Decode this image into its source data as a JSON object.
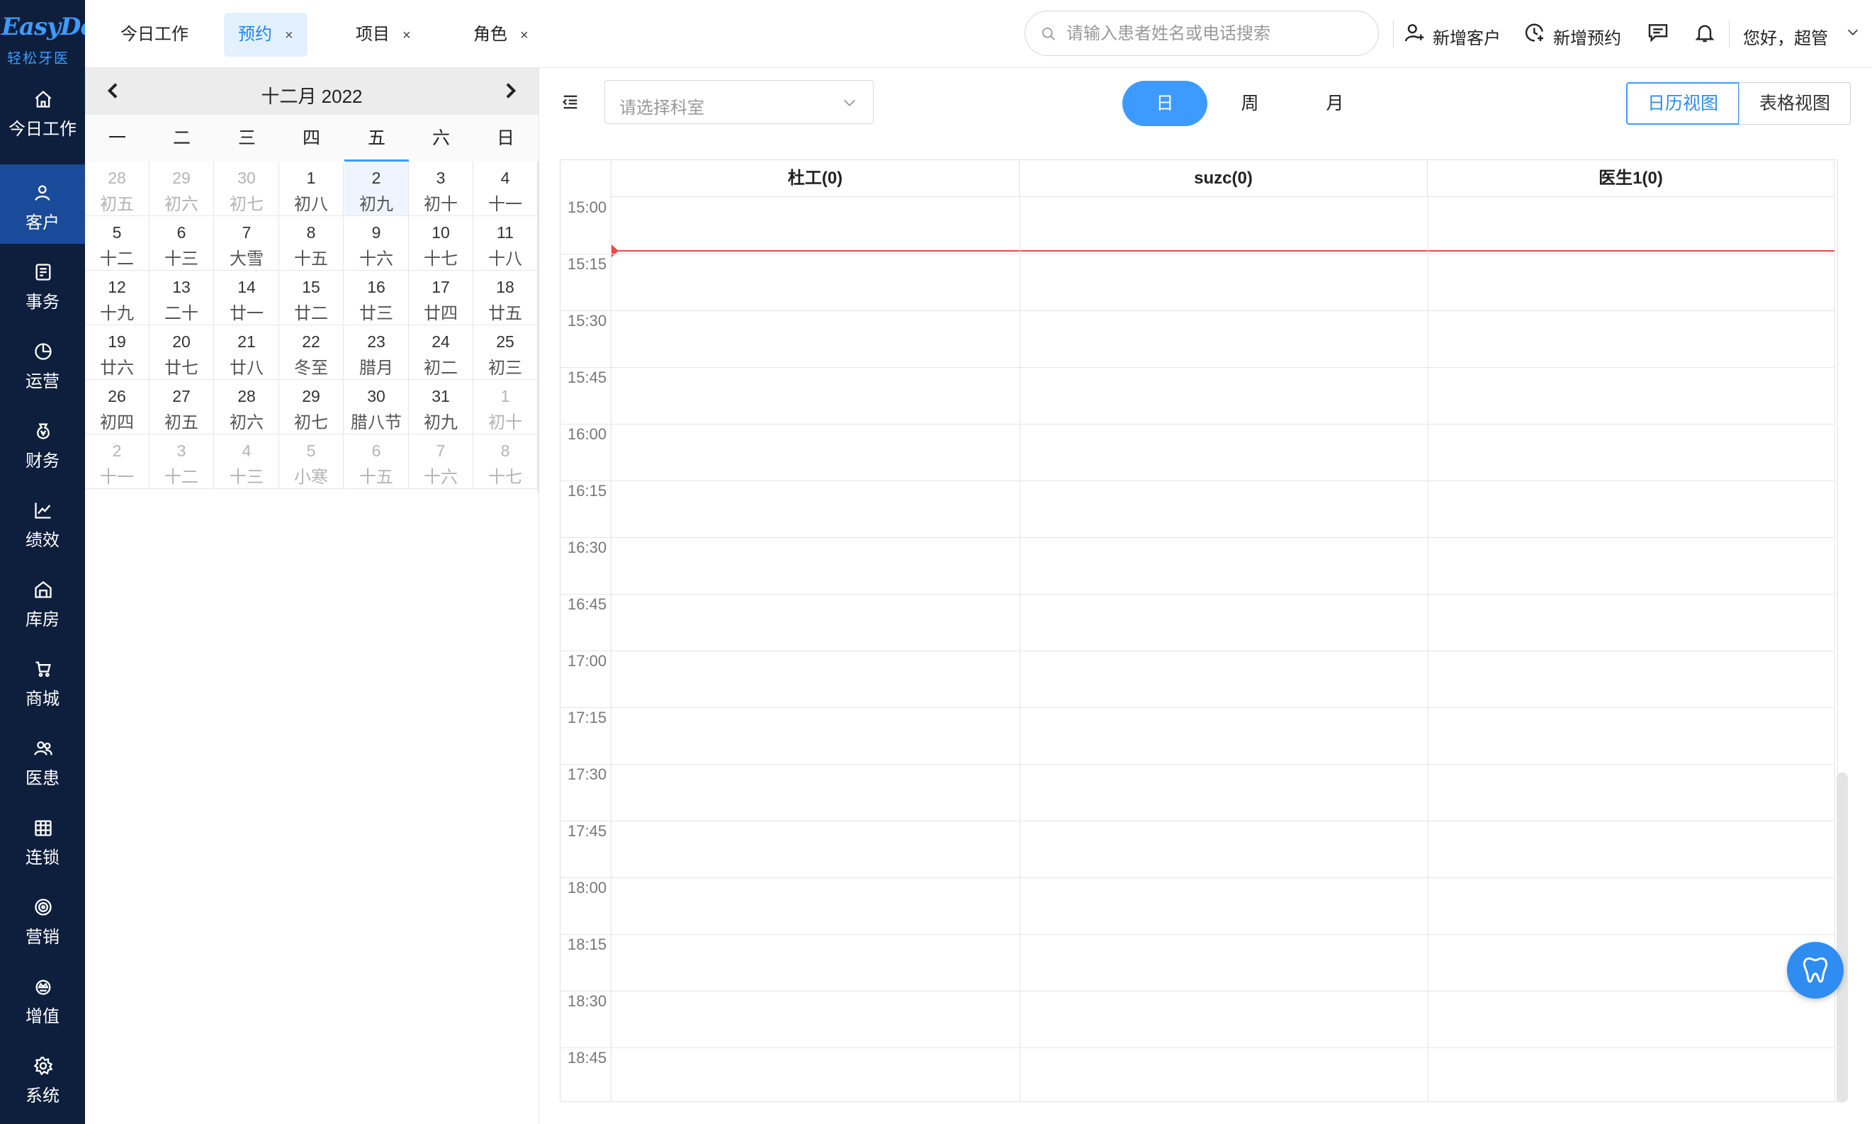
{
  "brand": {
    "name": "EasyDent",
    "subtitle": "轻松牙医",
    "accent": "#3d9bff"
  },
  "sidebar": {
    "items": [
      {
        "label": "今日工作",
        "icon": "home-icon"
      },
      {
        "label": "客户",
        "icon": "user-icon"
      },
      {
        "label": "事务",
        "icon": "document-icon"
      },
      {
        "label": "运营",
        "icon": "pie-chart-icon"
      },
      {
        "label": "财务",
        "icon": "money-bag-icon"
      },
      {
        "label": "绩效",
        "icon": "line-chart-icon"
      },
      {
        "label": "库房",
        "icon": "warehouse-icon"
      },
      {
        "label": "商城",
        "icon": "cart-icon"
      },
      {
        "label": "医患",
        "icon": "people-icon"
      },
      {
        "label": "连锁",
        "icon": "store-icon"
      },
      {
        "label": "营销",
        "icon": "target-icon"
      },
      {
        "label": "增值",
        "icon": "crown-icon"
      },
      {
        "label": "系统",
        "icon": "gear-icon"
      }
    ],
    "active_index": 1
  },
  "tabs": [
    {
      "label": "今日工作",
      "closable": false,
      "active": false
    },
    {
      "label": "预约",
      "closable": true,
      "active": true
    },
    {
      "label": "项目",
      "closable": true,
      "active": false
    },
    {
      "label": "角色",
      "closable": true,
      "active": false
    }
  ],
  "tab_close_glyph": "×",
  "search": {
    "placeholder": "请输入患者姓名或电话搜索",
    "value": ""
  },
  "actions": {
    "new_customer": "新增客户",
    "new_appointment": "新增预约",
    "greeting": "您好，超管"
  },
  "mini_calendar": {
    "title": "十二月 2022",
    "weekdays": [
      "一",
      "二",
      "三",
      "四",
      "五",
      "六",
      "日"
    ],
    "today_weekday_index": 4,
    "weeks": [
      [
        {
          "d": "28",
          "l": "初五",
          "dim": true
        },
        {
          "d": "29",
          "l": "初六",
          "dim": true
        },
        {
          "d": "30",
          "l": "初七",
          "dim": true
        },
        {
          "d": "1",
          "l": "初八"
        },
        {
          "d": "2",
          "l": "初九",
          "sel": true
        },
        {
          "d": "3",
          "l": "初十"
        },
        {
          "d": "4",
          "l": "十一"
        }
      ],
      [
        {
          "d": "5",
          "l": "十二"
        },
        {
          "d": "6",
          "l": "十三"
        },
        {
          "d": "7",
          "l": "大雪"
        },
        {
          "d": "8",
          "l": "十五"
        },
        {
          "d": "9",
          "l": "十六"
        },
        {
          "d": "10",
          "l": "十七"
        },
        {
          "d": "11",
          "l": "十八"
        }
      ],
      [
        {
          "d": "12",
          "l": "十九"
        },
        {
          "d": "13",
          "l": "二十"
        },
        {
          "d": "14",
          "l": "廿一"
        },
        {
          "d": "15",
          "l": "廿二"
        },
        {
          "d": "16",
          "l": "廿三"
        },
        {
          "d": "17",
          "l": "廿四"
        },
        {
          "d": "18",
          "l": "廿五"
        }
      ],
      [
        {
          "d": "19",
          "l": "廿六"
        },
        {
          "d": "20",
          "l": "廿七"
        },
        {
          "d": "21",
          "l": "廿八"
        },
        {
          "d": "22",
          "l": "冬至"
        },
        {
          "d": "23",
          "l": "腊月"
        },
        {
          "d": "24",
          "l": "初二"
        },
        {
          "d": "25",
          "l": "初三"
        }
      ],
      [
        {
          "d": "26",
          "l": "初四"
        },
        {
          "d": "27",
          "l": "初五"
        },
        {
          "d": "28",
          "l": "初六"
        },
        {
          "d": "29",
          "l": "初七"
        },
        {
          "d": "30",
          "l": "腊八节"
        },
        {
          "d": "31",
          "l": "初九"
        },
        {
          "d": "1",
          "l": "初十",
          "dim": true
        }
      ],
      [
        {
          "d": "2",
          "l": "十一",
          "dim": true
        },
        {
          "d": "3",
          "l": "十二",
          "dim": true
        },
        {
          "d": "4",
          "l": "十三",
          "dim": true
        },
        {
          "d": "5",
          "l": "小寒",
          "dim": true
        },
        {
          "d": "6",
          "l": "十五",
          "dim": true
        },
        {
          "d": "7",
          "l": "十六",
          "dim": true
        },
        {
          "d": "8",
          "l": "十七",
          "dim": true
        }
      ]
    ]
  },
  "toolbar": {
    "department_placeholder": "请选择科室",
    "views": [
      "日",
      "周",
      "月"
    ],
    "active_view": "日",
    "layout_buttons": [
      "日历视图",
      "表格视图"
    ],
    "active_layout": "日历视图"
  },
  "schedule": {
    "columns": [
      "杜工(0)",
      "suzc(0)",
      "医生1(0)"
    ],
    "time_slots": [
      "15:00",
      "15:15",
      "15:30",
      "15:45",
      "16:00",
      "16:15",
      "16:30",
      "16:45",
      "17:00",
      "17:15",
      "17:30",
      "17:45",
      "18:00",
      "18:15",
      "18:30",
      "18:45"
    ],
    "now_indicator_color": "#f04848"
  },
  "fab": {
    "icon": "tooth-icon",
    "color": "#2f8cf0"
  }
}
